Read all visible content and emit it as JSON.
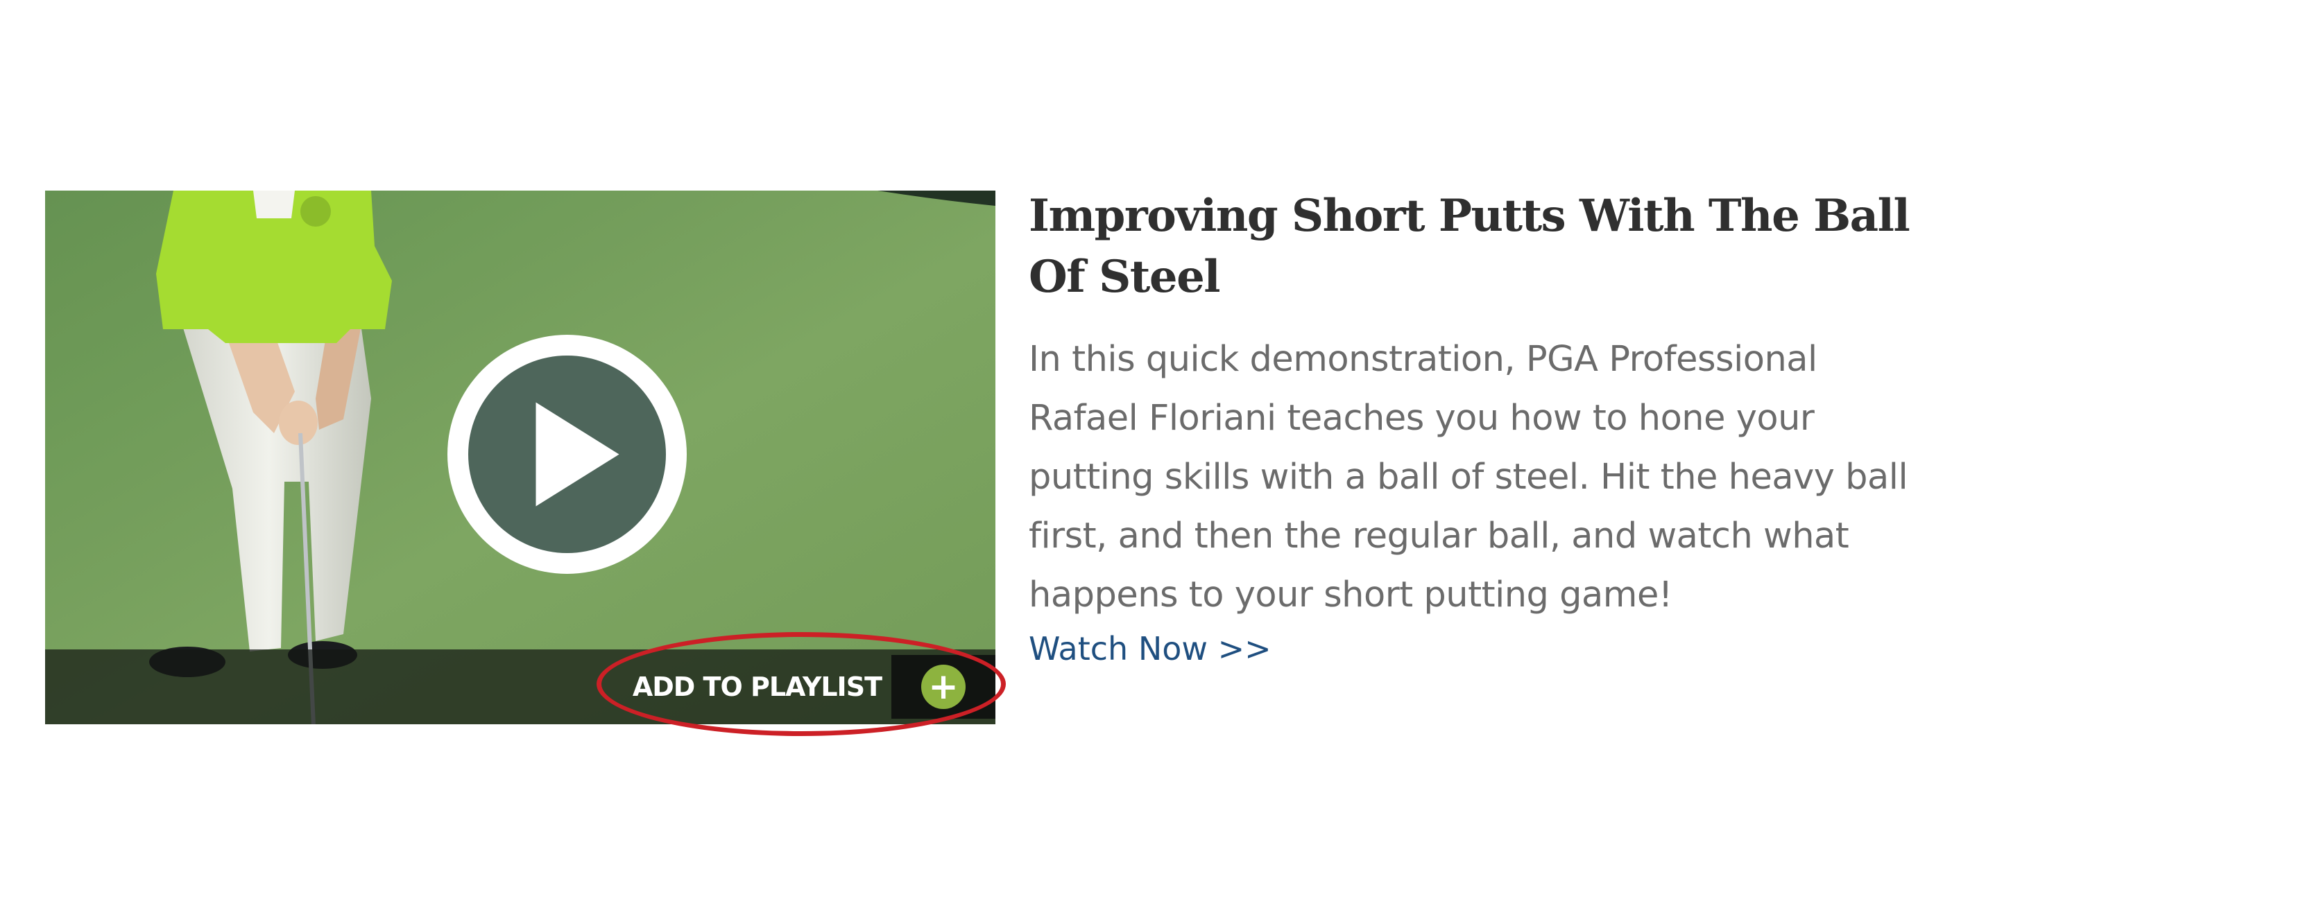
{
  "video": {
    "thumbnail_alt": "Golfer putting on green",
    "play_icon": "play-icon",
    "playlist_button_label": "ADD TO PLAYLIST",
    "plus_icon": "plus-icon",
    "accent_color": "#8db33f",
    "annotation_color": "#cc2026"
  },
  "article": {
    "title": "Improving Short Putts With The Ball Of Steel",
    "description": "In this quick demonstration, PGA Professional Rafael Floriani teaches you how to hone your putting skills with a ball of steel. Hit the heavy ball first, and then the regular ball, and watch what happens to your short putting game!",
    "watch_now_label": "Watch Now >>"
  }
}
